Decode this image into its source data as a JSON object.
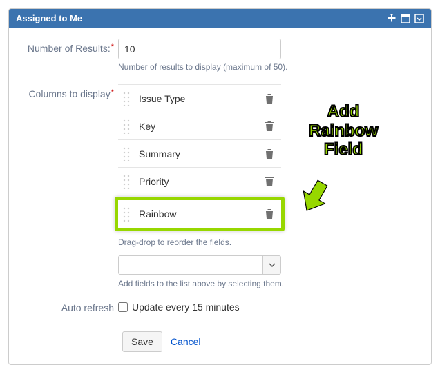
{
  "header": {
    "title": "Assigned to Me"
  },
  "form": {
    "numResults": {
      "label": "Number of Results:",
      "value": "10",
      "helper": "Number of results to display (maximum of 50)."
    },
    "columns": {
      "label": "Columns to display",
      "items": [
        {
          "label": "Issue Type",
          "highlight": false
        },
        {
          "label": "Key",
          "highlight": false
        },
        {
          "label": "Summary",
          "highlight": false
        },
        {
          "label": "Priority",
          "highlight": false
        },
        {
          "label": "Rainbow",
          "highlight": true
        }
      ],
      "reorderHelper": "Drag-drop to reorder the fields.",
      "selectHelper": "Add fields to the list above by selecting them."
    },
    "autoRefresh": {
      "label": "Auto refresh",
      "checkboxLabel": "Update every 15 minutes",
      "checked": false
    },
    "actions": {
      "save": "Save",
      "cancel": "Cancel"
    }
  },
  "annotation": {
    "line1": "Add",
    "line2": "Rainbow",
    "line3": "Field"
  }
}
